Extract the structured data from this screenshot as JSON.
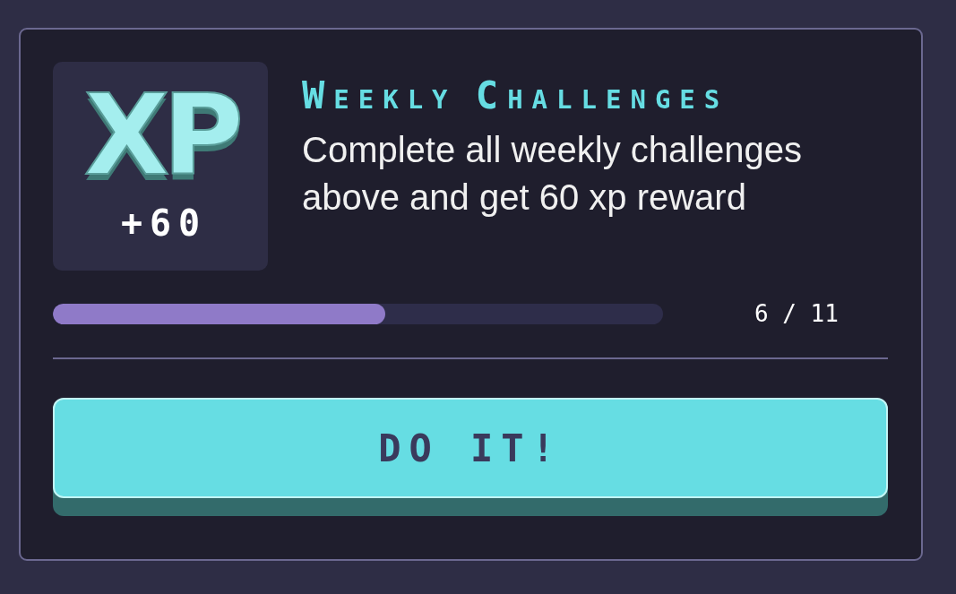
{
  "card": {
    "badge": {
      "logo": "XP",
      "reward": "+60"
    },
    "title": "Weekly Challenges",
    "description": "Complete all weekly challenges above and get 60 xp reward",
    "progress": {
      "level": 0.545,
      "count": "6 / 11"
    },
    "button": {
      "label": "DO IT!"
    }
  }
}
